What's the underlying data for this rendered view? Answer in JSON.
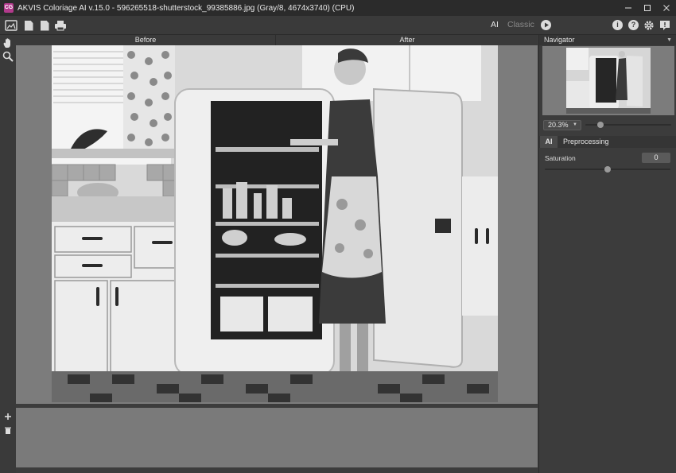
{
  "window": {
    "title": "AKVIS Coloriage AI v.15.0 - 596265518-shutterstock_99385886.jpg (Gray/8, 4674x3740) (CPU)",
    "logo_text": "CG"
  },
  "window_controls": [
    "minimize-icon",
    "maximize-icon",
    "close-icon"
  ],
  "toolbar": {
    "left_icons": [
      "open-image-icon",
      "open-file-icon",
      "save-file-icon",
      "print-icon"
    ],
    "mode_tabs": {
      "ai": "AI",
      "classic": "Classic",
      "active": "AI"
    },
    "right_icons": [
      "run-icon",
      "info-icon",
      "help-icon",
      "settings-icon",
      "notifications-icon"
    ]
  },
  "tools": [
    "hand-tool-icon",
    "zoom-tool-icon"
  ],
  "view": {
    "before_tab": "Before",
    "after_tab": "After"
  },
  "navigator": {
    "title": "Navigator",
    "zoom": "20.3%",
    "zoom_slider_value": 0.18
  },
  "settings_panel": {
    "tabs": [
      "AI",
      "Preprocessing"
    ],
    "active_tab": "AI",
    "saturation_label": "Saturation",
    "saturation_value": "0",
    "saturation_slider_value": 0.5
  },
  "lower_panel": {
    "buttons": [
      "add-icon",
      "delete-icon"
    ]
  },
  "colors": {
    "background": "#3c3c3c",
    "title_bar": "#2b2b2b",
    "canvas": "#7c7c7c"
  }
}
